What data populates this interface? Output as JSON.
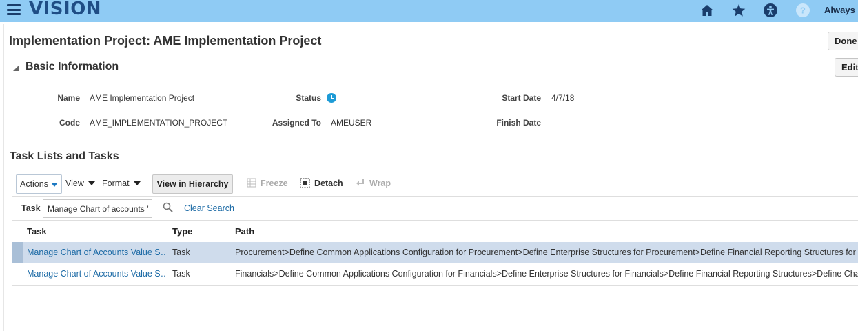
{
  "header": {
    "logo": "VISION",
    "user_menu": "Always",
    "icons": [
      "menu-icon",
      "home-icon",
      "favorites-star-icon",
      "accessibility-icon",
      "help-icon"
    ]
  },
  "page": {
    "title": "Implementation Project: AME Implementation Project",
    "done_label": "Done",
    "edit_label": "Edit"
  },
  "basic_info": {
    "title": "Basic Information",
    "name_label": "Name",
    "name_value": "AME Implementation Project",
    "code_label": "Code",
    "code_value": "AME_IMPLEMENTATION_PROJECT",
    "status_label": "Status",
    "assigned_label": "Assigned To",
    "assigned_value": "AMEUSER",
    "start_label": "Start Date",
    "start_value": "4/7/18",
    "finish_label": "Finish Date",
    "finish_value": ""
  },
  "tasks": {
    "title": "Task Lists and Tasks",
    "toolbar": {
      "actions": "Actions",
      "view": "View",
      "format": "Format",
      "view_hierarchy": "View in Hierarchy",
      "freeze": "Freeze",
      "detach": "Detach",
      "wrap": "Wrap"
    },
    "search": {
      "label": "Task",
      "value": "Manage Chart of accounts ’",
      "clear": "Clear Search"
    },
    "columns": [
      "Task",
      "Type",
      "Path"
    ],
    "rows": [
      {
        "task": "Manage Chart of Accounts Value S…",
        "type": "Task",
        "path": "Procurement>Define Common Applications Configuration for Procurement>Define Enterprise Structures for Procurement>Define Financial Reporting Structures for Procurement"
      },
      {
        "task": "Manage Chart of Accounts Value S…",
        "type": "Task",
        "path": "Financials>Define Common Applications Configuration for Financials>Define Enterprise Structures for Financials>Define Financial Reporting Structures>Define Chart of Accounts"
      }
    ]
  },
  "colors": {
    "topbar": "#8fcbf4",
    "logo": "#1f4d85",
    "link": "#1d6ba6",
    "selected_row": "#cfdcec",
    "status_icon": "#1d9bd6"
  }
}
